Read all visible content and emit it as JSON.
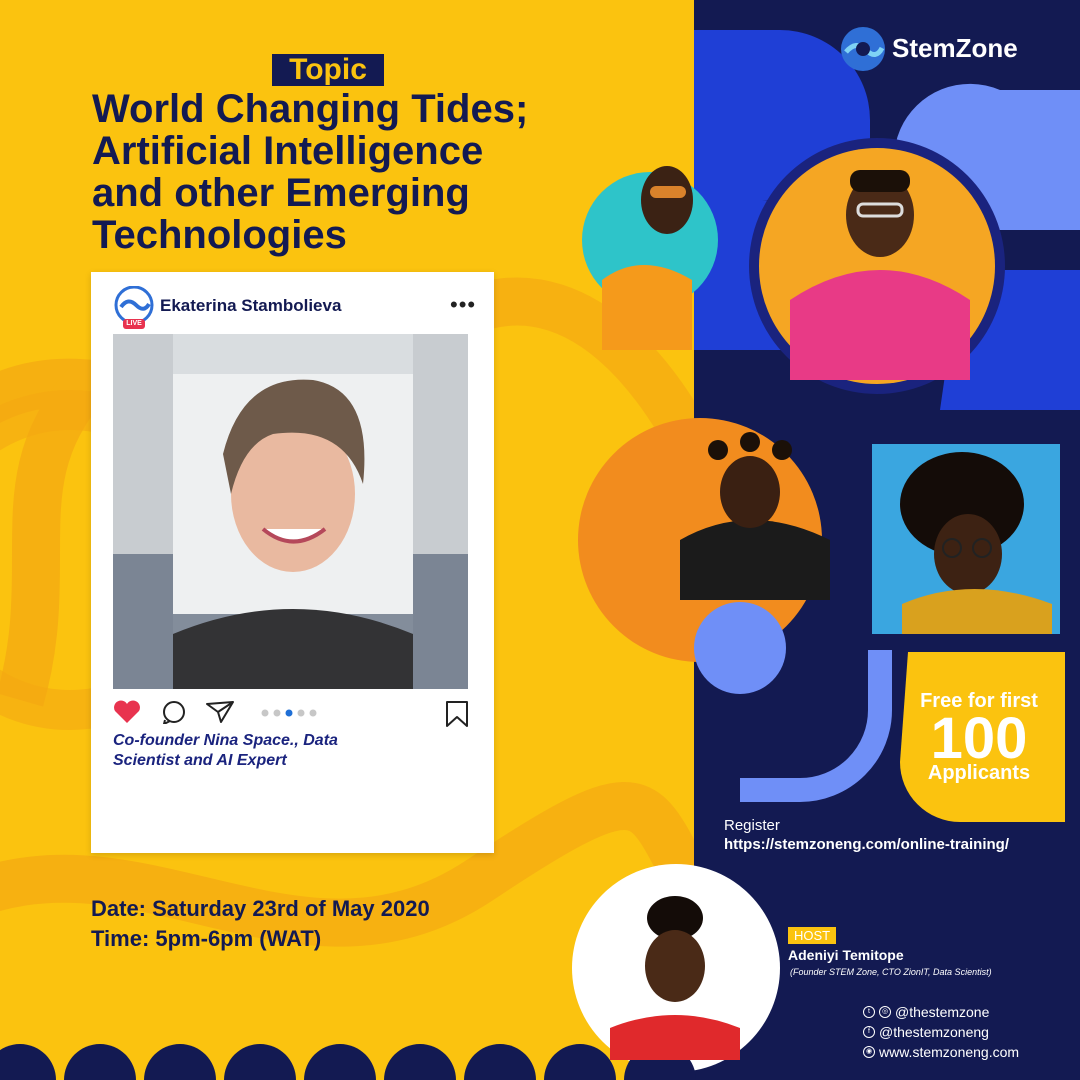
{
  "header": {
    "topic_label": "Topic",
    "title_lines": [
      "World Changing Tides;",
      "Artificial Intelligence",
      "and other Emerging",
      "Technologies"
    ]
  },
  "brand": {
    "name": "StemZone",
    "logo_icon": "stemzone-wave-logo-icon"
  },
  "post_card": {
    "username": "Ekaterina Stambolieva",
    "live_badge": "LIVE",
    "more_icon": "more-dots-icon",
    "more_label": "•••",
    "actions": [
      "heart-icon",
      "comment-icon",
      "share-icon",
      "bookmark-icon"
    ],
    "carousel_dots": 5,
    "carousel_active": 3,
    "caption_lines": [
      "Co-founder Nina Space., Data",
      "Scientist and AI Expert"
    ]
  },
  "event": {
    "date": "Date: Saturday 23rd of May 2020",
    "time": "Time: 5pm-6pm (WAT)"
  },
  "offer": {
    "line1": "Free for first",
    "line2": "100",
    "line3": "Applicants"
  },
  "register": {
    "label": "Register",
    "url": "https://stemzoneng.com/online-training/"
  },
  "host": {
    "tag": "HOST",
    "name": "Adeniyi Temitope",
    "role": "(Founder STEM Zone, CTO ZionIT, Data Scientist)"
  },
  "socials": [
    {
      "icons": "twitter-instagram-icon",
      "text": "@thestemzone"
    },
    {
      "icons": "facebook-icon",
      "text": "@thestemzoneng"
    },
    {
      "icons": "globe-icon",
      "text": "www.stemzoneng.com"
    }
  ],
  "colors": {
    "yellow": "#fbc30f",
    "navy": "#131a52",
    "blue": "#1f3fd6",
    "light_blue": "#6f8ff7",
    "orange": "#f4a020",
    "heart": "#e8334f"
  }
}
